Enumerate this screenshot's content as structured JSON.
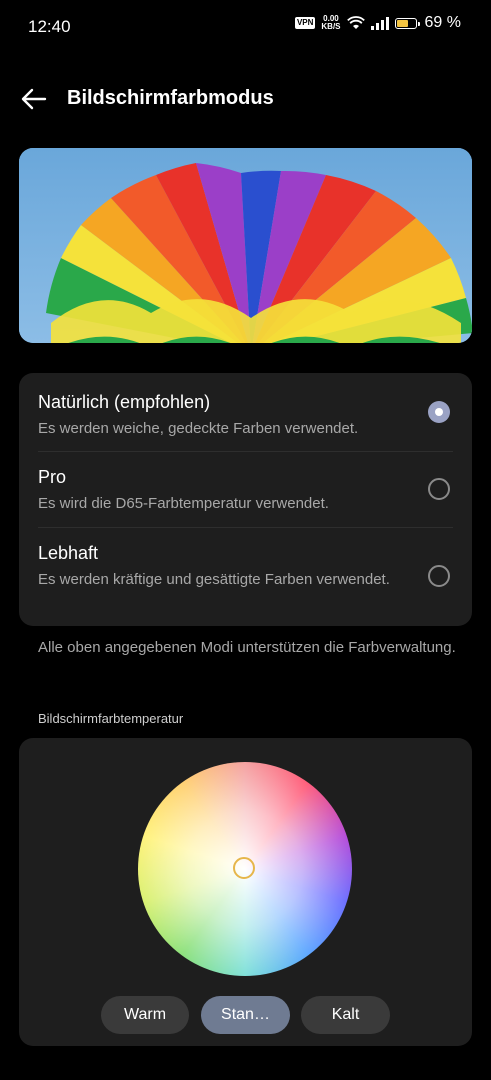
{
  "status": {
    "time": "12:40",
    "vpn": "VPN",
    "net_speed_value": "0.00",
    "net_speed_unit": "KB/S",
    "battery_percent": "69 %",
    "battery_level": 0.69,
    "battery_color": "#f5c542"
  },
  "header": {
    "back_icon": "arrow-left-icon",
    "title": "Bildschirmfarbmodus"
  },
  "modes": [
    {
      "title": "Natürlich (empfohlen)",
      "description": "Es werden weiche, gedeckte Farben verwendet.",
      "selected": true
    },
    {
      "title": "Pro",
      "description": "Es wird die D65-Farbtemperatur verwendet.",
      "selected": false
    },
    {
      "title": "Lebhaft",
      "description": "Es werden kräftige und gesättigte Farben verwendet.",
      "selected": false
    }
  ],
  "note": "Alle oben angegebenen Modi unterstützen die Farbverwaltung.",
  "temperature": {
    "section_label": "Bildschirmfarbtemperatur",
    "presets": [
      {
        "label": "Warm",
        "active": false
      },
      {
        "label": "Stan…",
        "active": true
      },
      {
        "label": "Kalt",
        "active": false
      }
    ]
  },
  "colors": {
    "accent": "#9aa2c4",
    "card_bg": "#1e1e1e",
    "active_preset": "#6f7b92",
    "handle": "#e6b64a"
  }
}
